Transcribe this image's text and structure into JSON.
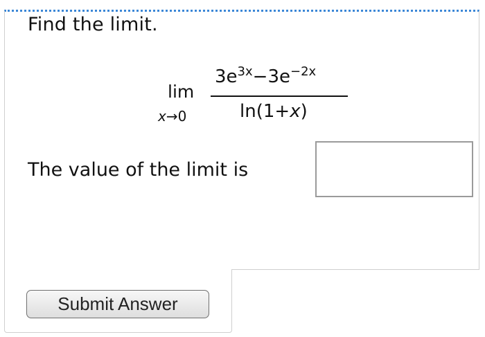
{
  "question": {
    "prompt": "Find the limit.",
    "limit": {
      "operator": "lim",
      "approach_var": "x",
      "arrow": "→",
      "approach_value": "0",
      "numerator": {
        "coef1": "3e",
        "exp1": "3x",
        "minus": "−",
        "coef2": "3e",
        "exp2": "−2x"
      },
      "denominator": {
        "func": "ln(1+",
        "var": "x",
        "close": ")"
      }
    },
    "answer_label": "The value of the limit is",
    "answer_value": ""
  },
  "actions": {
    "submit_label": "Submit Answer"
  }
}
